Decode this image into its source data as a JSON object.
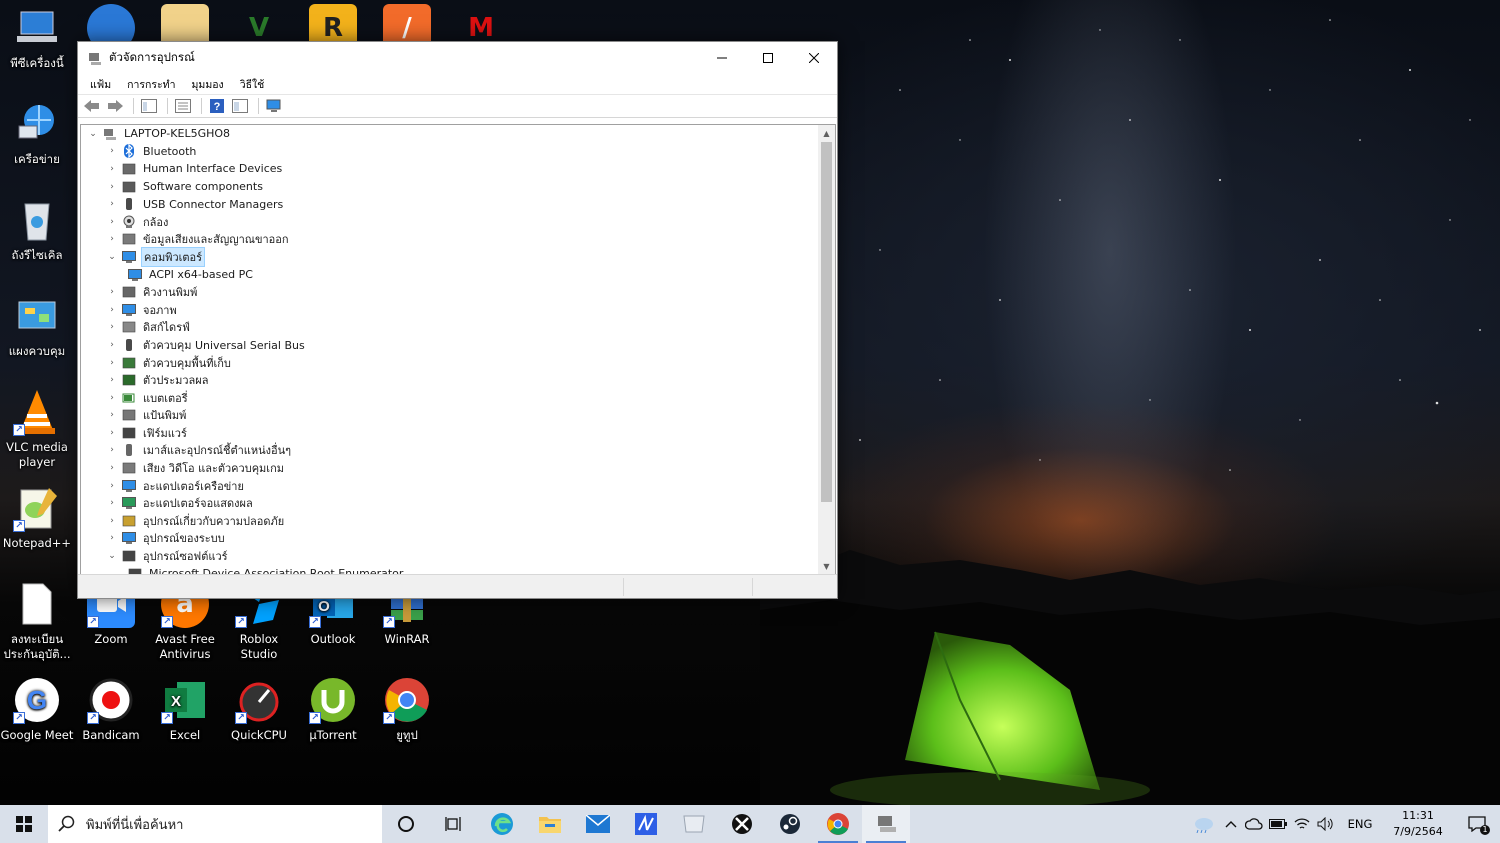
{
  "desktop": {
    "icons_left": [
      {
        "label": "พีซีเครื่องนี้",
        "icon": "computer-icon"
      },
      {
        "label": "เครือข่าย",
        "icon": "network-icon"
      },
      {
        "label": "ถังรีไซเคิล",
        "icon": "recycle-bin-icon"
      },
      {
        "label": "แผงควบคุม",
        "icon": "control-panel-icon"
      },
      {
        "label": "VLC media player",
        "icon": "vlc-icon"
      },
      {
        "label": "Notepad++",
        "icon": "notepad-plus-icon"
      },
      {
        "label": "ลงทะเบียนประกันอุบัติ...",
        "icon": "document-icon"
      },
      {
        "label": "Google Meet",
        "icon": "google-meet-icon"
      }
    ],
    "icons_row1": [
      {
        "label": "Zoom",
        "icon": "zoom-icon"
      },
      {
        "label": "Avast Free Antivirus",
        "icon": "avast-icon"
      },
      {
        "label": "Roblox Studio",
        "icon": "roblox-studio-icon"
      },
      {
        "label": "Outlook",
        "icon": "outlook-icon"
      },
      {
        "label": "WinRAR",
        "icon": "winrar-icon"
      }
    ],
    "icons_row2": [
      {
        "label": "Bandicam",
        "icon": "bandicam-icon"
      },
      {
        "label": "Excel",
        "icon": "excel-icon"
      },
      {
        "label": "QuickCPU",
        "icon": "quickcpu-icon"
      },
      {
        "label": "µTorrent",
        "icon": "utorrent-icon"
      },
      {
        "label": "ยูทูป",
        "icon": "chrome-icon"
      }
    ]
  },
  "window": {
    "title": "ตัวจัดการอุปกรณ์",
    "menu": [
      "แฟ้ม",
      "การกระทำ",
      "มุมมอง",
      "วิธีใช้"
    ],
    "tree": {
      "root": "LAPTOP-KEL5GHO8",
      "items": [
        {
          "label": "Bluetooth",
          "expanded": false,
          "icon": "bluetooth-icon"
        },
        {
          "label": "Human Interface Devices",
          "expanded": false,
          "icon": "hid-icon"
        },
        {
          "label": "Software components",
          "expanded": false,
          "icon": "software-component-icon"
        },
        {
          "label": "USB Connector Managers",
          "expanded": false,
          "icon": "usb-icon"
        },
        {
          "label": "กล้อง",
          "expanded": false,
          "icon": "camera-icon"
        },
        {
          "label": "ข้อมูลเสียงและสัญญาณขาออก",
          "expanded": false,
          "icon": "speaker-icon"
        },
        {
          "label": "คอมพิวเตอร์",
          "expanded": true,
          "selected": true,
          "icon": "monitor-icon"
        },
        {
          "label": "ACPI x64-based PC",
          "child": true,
          "icon": "monitor-icon"
        },
        {
          "label": "คิวงานพิมพ์",
          "expanded": false,
          "icon": "printer-icon"
        },
        {
          "label": "จอภาพ",
          "expanded": false,
          "icon": "monitor-icon"
        },
        {
          "label": "ดิสก์ไดรฟ์",
          "expanded": false,
          "icon": "disk-drive-icon"
        },
        {
          "label": "ตัวควบคุม Universal Serial Bus",
          "expanded": false,
          "icon": "usb-icon"
        },
        {
          "label": "ตัวควบคุมพื้นที่เก็บ",
          "expanded": false,
          "icon": "storage-controller-icon"
        },
        {
          "label": "ตัวประมวลผล",
          "expanded": false,
          "icon": "processor-icon"
        },
        {
          "label": "แบตเตอรี่",
          "expanded": false,
          "icon": "battery-icon"
        },
        {
          "label": "แป้นพิมพ์",
          "expanded": false,
          "icon": "keyboard-icon"
        },
        {
          "label": "เฟิร์มแวร์",
          "expanded": false,
          "icon": "firmware-icon"
        },
        {
          "label": "เมาส์และอุปกรณ์ชี้ตำแหน่งอื่นๆ",
          "expanded": false,
          "icon": "mouse-icon"
        },
        {
          "label": "เสียง วิดีโอ และตัวควบคุมเกม",
          "expanded": false,
          "icon": "speaker-icon"
        },
        {
          "label": "อะแดปเตอร์เครือข่าย",
          "expanded": false,
          "icon": "network-adapter-icon"
        },
        {
          "label": "อะแดปเตอร์จอแสดงผล",
          "expanded": false,
          "icon": "display-adapter-icon"
        },
        {
          "label": "อุปกรณ์เกี่ยวกับความปลอดภัย",
          "expanded": false,
          "icon": "security-device-icon"
        },
        {
          "label": "อุปกรณ์ของระบบ",
          "expanded": false,
          "icon": "system-device-icon"
        },
        {
          "label": "อุปกรณ์ซอฟต์แวร์",
          "expanded": true,
          "icon": "software-device-icon"
        },
        {
          "label": "Microsoft Device Association Root Enumerator",
          "child": true,
          "icon": "software-device-icon"
        }
      ]
    }
  },
  "taskbar": {
    "search_placeholder": "พิมพ์ที่นี่เพื่อค้นหา",
    "language": "ENG",
    "time": "11:31",
    "date": "7/9/2564",
    "notification_count": "1"
  }
}
